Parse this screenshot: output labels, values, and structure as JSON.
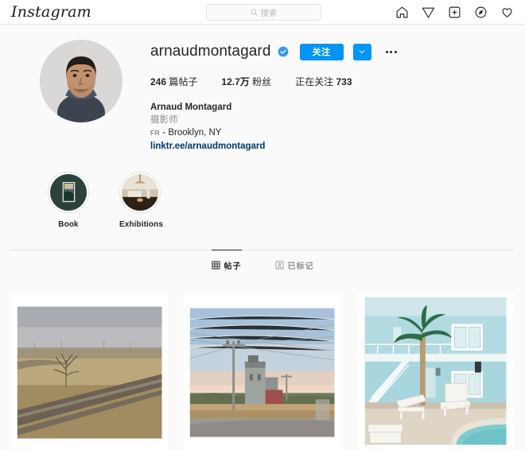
{
  "header": {
    "logo_text": "Instagram",
    "search": {
      "placeholder": "搜索",
      "icon": "search-icon"
    },
    "nav": [
      {
        "name": "home-icon",
        "label": "主页"
      },
      {
        "name": "paper-plane-icon",
        "label": "私信"
      },
      {
        "name": "plus-square-icon",
        "label": "新建帖子"
      },
      {
        "name": "compass-icon",
        "label": "探索"
      },
      {
        "name": "heart-icon",
        "label": "动态"
      }
    ]
  },
  "profile": {
    "avatar_alt": "arnaudmontagard 头像",
    "username": "arnaudmontagard",
    "verified": true,
    "follow_button": "关注",
    "caret_button": "chevron-down-icon",
    "more_button": "options-icon",
    "stats": {
      "posts_count": "246",
      "posts_label": "篇帖子",
      "followers_count": "12.7万",
      "followers_label": "粉丝",
      "following_label": "正在关注",
      "following_count": "733"
    },
    "bio": {
      "full_name": "Arnaud Montagard",
      "occupation": "摄影师",
      "country_code": "FR",
      "location": "- Brooklyn, NY",
      "link": "linktr.ee/arnaudmontagard"
    }
  },
  "highlights": [
    {
      "label": "Book",
      "cover": "dark-green-framed-photo"
    },
    {
      "label": "Exhibitions",
      "cover": "gallery-interior-pendant-lamp"
    }
  ],
  "tabs": [
    {
      "label": "帖子",
      "icon": "grid-icon",
      "active": true
    },
    {
      "label": "已标记",
      "icon": "tagged-person-icon",
      "active": false
    }
  ],
  "posts": [
    {
      "name": "post-railroad-prairie",
      "alt": "铁轨穿过干草原，孤树与阴天",
      "colors": {
        "sky": "#b9bcc0",
        "field": "#b49b6d",
        "track": "#6e6354"
      }
    },
    {
      "name": "post-grain-elevator-dusk",
      "alt": "黄昏中的谷仓塔与电线杆",
      "colors": {
        "sky": "#a9c3d8",
        "glow": "#e8c3ae",
        "ground": "#9a9793"
      }
    },
    {
      "name": "post-blue-motel-pool",
      "alt": "浅蓝色汽车旅馆，棕榈树与泳池躺椅",
      "colors": {
        "wall": "#b3dbe2",
        "deck": "#ded7c9",
        "pool": "#8fd3d2"
      }
    }
  ],
  "theme": {
    "accent_blue": "#0095f6",
    "link_blue": "#00376b",
    "text_primary": "#262626",
    "text_muted": "#8e8e8e",
    "page_bg": "#fafafa",
    "header_bg": "#ffffff"
  }
}
